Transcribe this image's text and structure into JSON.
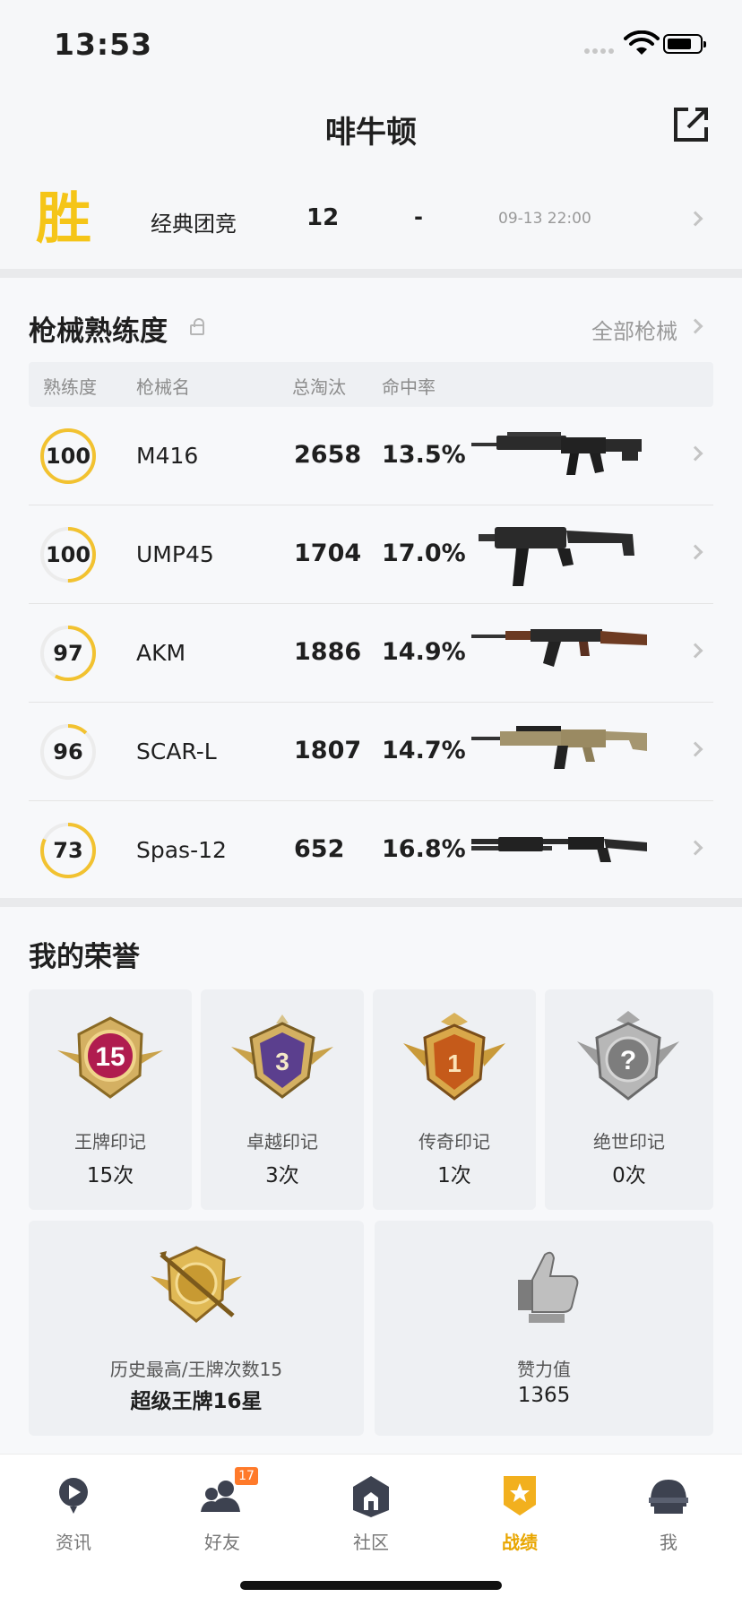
{
  "status": {
    "time": "13:53"
  },
  "header": {
    "title": "啡牛顿"
  },
  "match": {
    "result": "胜",
    "mode": "经典团竞",
    "kills": "12",
    "rank": "-",
    "date": "09-13 22:00"
  },
  "weapons": {
    "title": "枪械熟练度",
    "all_link": "全部枪械",
    "columns": {
      "level": "熟练度",
      "name": "枪械名",
      "kills": "总淘汰",
      "hit_rate": "命中率"
    },
    "rows": [
      {
        "level": "100",
        "name": "M416",
        "kills": "2658",
        "hit": "13.5%",
        "progress": 1.0
      },
      {
        "level": "100",
        "name": "UMP45",
        "kills": "1704",
        "hit": "17.0%",
        "progress": 0.5
      },
      {
        "level": "97",
        "name": "AKM",
        "kills": "1886",
        "hit": "14.9%",
        "progress": 0.58
      },
      {
        "level": "96",
        "name": "SCAR-L",
        "kills": "1807",
        "hit": "14.7%",
        "progress": 0.12
      },
      {
        "level": "73",
        "name": "Spas-12",
        "kills": "652",
        "hit": "16.8%",
        "progress": 0.82
      }
    ]
  },
  "honors": {
    "title": "我的荣誉",
    "items": [
      {
        "name": "王牌印记",
        "count": "15次",
        "badge_text": "15",
        "color": "#b01c4f"
      },
      {
        "name": "卓越印记",
        "count": "3次",
        "badge_text": "3",
        "color": "#5b3f8e"
      },
      {
        "name": "传奇印记",
        "count": "1次",
        "badge_text": "1",
        "color": "#c55a1a"
      },
      {
        "name": "绝世印记",
        "count": "0次",
        "badge_text": "?",
        "color": "#8a8a8a"
      }
    ],
    "highest": {
      "label": "历史最高/王牌次数15",
      "value": "超级王牌16星"
    },
    "likes": {
      "label": "赞力值",
      "value": "1365"
    }
  },
  "tabs": [
    {
      "label": "资讯",
      "icon": "news-icon"
    },
    {
      "label": "好友",
      "icon": "friends-icon",
      "badge": "17"
    },
    {
      "label": "社区",
      "icon": "community-icon"
    },
    {
      "label": "战绩",
      "icon": "record-icon",
      "active": true
    },
    {
      "label": "我",
      "icon": "helmet-icon"
    }
  ],
  "colors": {
    "accent": "#f5c518",
    "active_tab": "#e9a600",
    "ring_track": "#ececec"
  }
}
